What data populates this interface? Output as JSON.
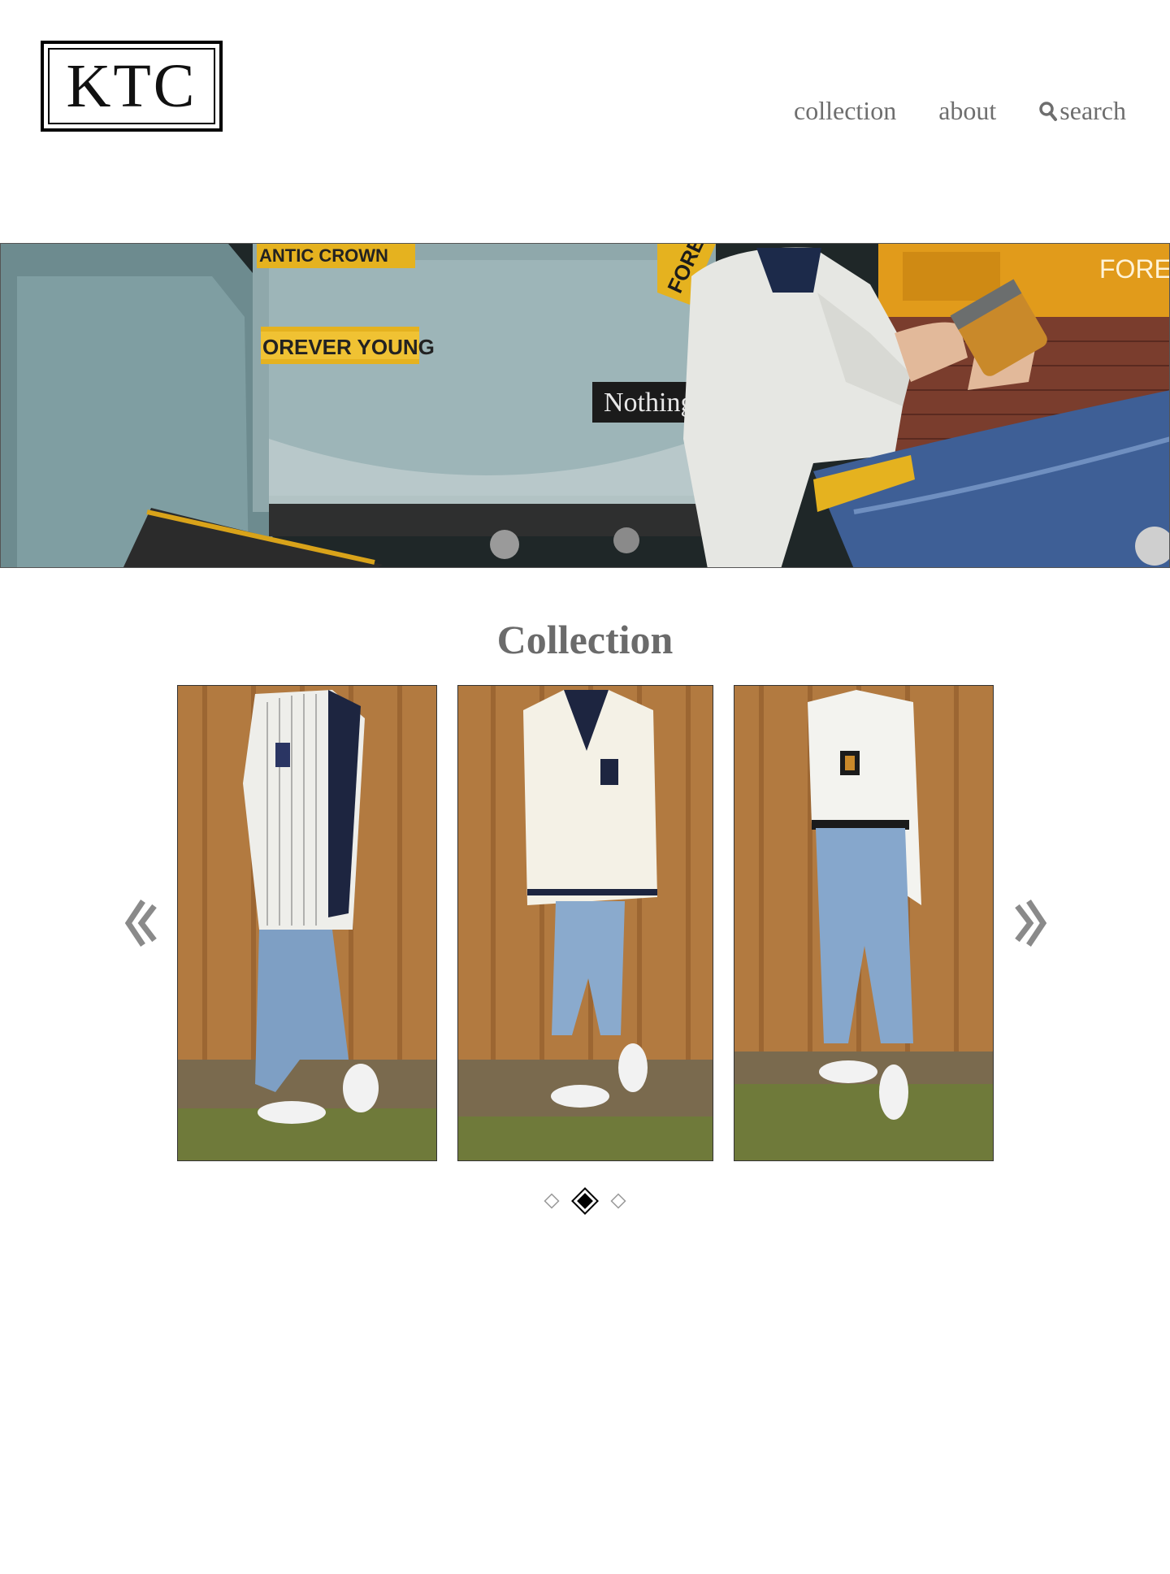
{
  "logo": {
    "text": "KTC"
  },
  "nav": {
    "items": [
      {
        "label": "collection"
      },
      {
        "label": "about"
      },
      {
        "label": "search"
      }
    ]
  },
  "hero": {
    "signs": {
      "sticker_top": "ANTIC CROWN",
      "sticker_middle": "OREVER YOUNG",
      "label_black": "Nothing",
      "sign_corner": "FORE",
      "sign_right": "FOREVE"
    }
  },
  "collection": {
    "title": "Collection",
    "items": [
      {
        "name": "striped cable knit sweater look"
      },
      {
        "name": "cream v-neck cricket sweater look"
      },
      {
        "name": "white shirt with crest patch look"
      }
    ],
    "pagination": {
      "total": 3,
      "active": 2
    }
  },
  "colors": {
    "nav_text": "#6e6e6e",
    "title_text": "#6b6b6b",
    "fence": "#b47a3e",
    "denim": "#7e9fc4"
  }
}
